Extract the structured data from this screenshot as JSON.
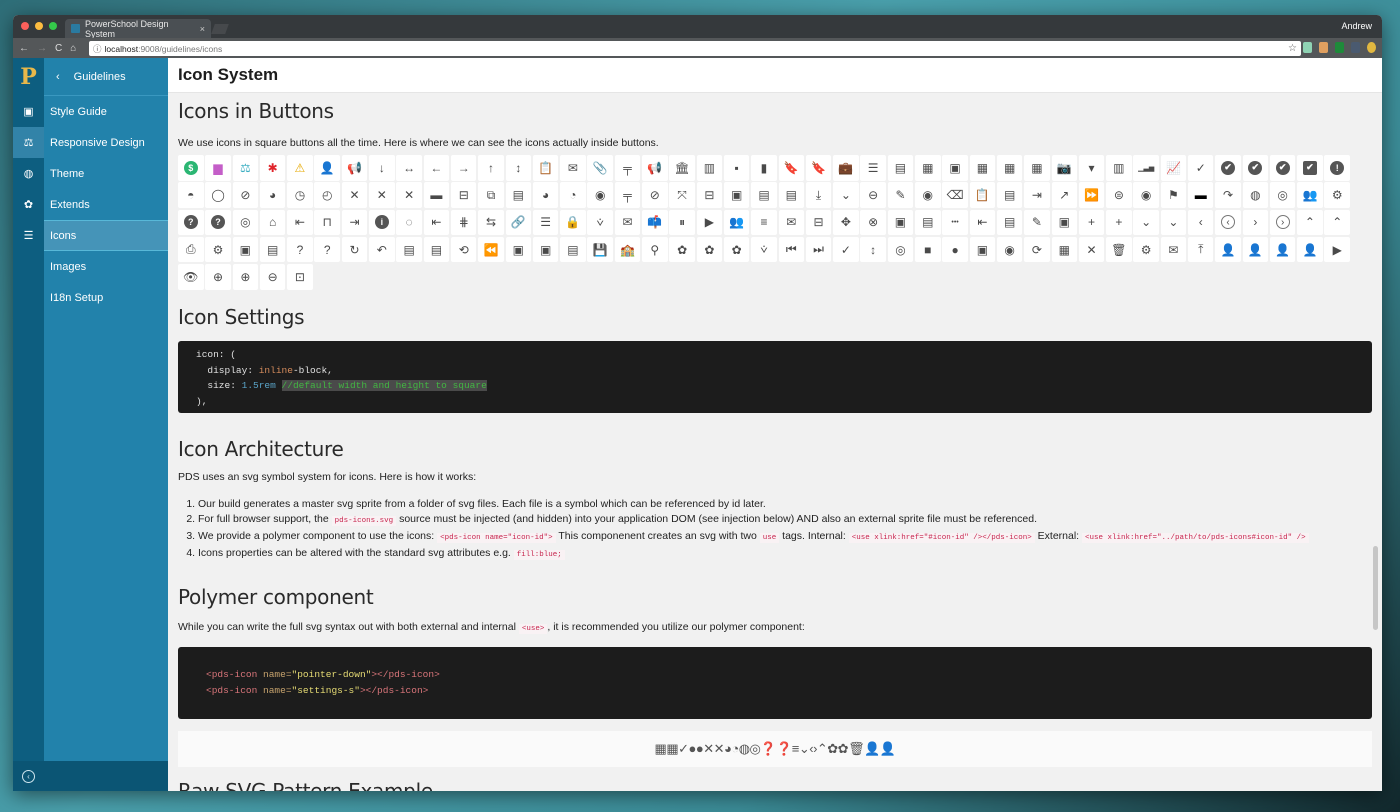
{
  "browser": {
    "tab_title": "PowerSchool Design System",
    "tab_close": "×",
    "user": "Andrew",
    "url_host": "localhost",
    "url_path": ":9008/guidelines/icons",
    "info_icon": "ⓘ",
    "star_icon": "☆",
    "nav": {
      "back": "←",
      "forward": "→",
      "reload": "C",
      "home": "⌂"
    }
  },
  "colors": {
    "sidebar_rail": "#0d5e80",
    "sidebar_nav": "#2282ab",
    "active_item": "#4594b8",
    "code_bg": "#1c1c1c"
  },
  "rail": {
    "logo": "P",
    "icons": [
      {
        "name": "style-guide-icon",
        "glyph": "▣"
      },
      {
        "name": "balance-icon",
        "glyph": "⚖"
      },
      {
        "name": "globe-icon",
        "glyph": "◍"
      },
      {
        "name": "gear-icon",
        "glyph": "✿"
      },
      {
        "name": "document-icon",
        "glyph": "☰"
      }
    ]
  },
  "sidenav": {
    "back_label": "Guidelines",
    "back_icon": "‹",
    "items": [
      {
        "label": "Style Guide"
      },
      {
        "label": "Responsive Design"
      },
      {
        "label": "Theme"
      },
      {
        "label": "Extends"
      },
      {
        "label": "Icons",
        "active": true
      },
      {
        "label": "Images"
      },
      {
        "label": "I18n Setup"
      }
    ],
    "collapse_icon": "‹"
  },
  "page": {
    "title": "Icon System",
    "sections": {
      "buttons": {
        "heading": "Icons in Buttons",
        "text": "We use icons in square buttons all the time. Here is where we can see the icons actually inside buttons."
      },
      "settings": {
        "heading": "Icon Settings",
        "code": {
          "l1": "icon: (",
          "l2a": "display: ",
          "l2b": "inline",
          "l2c": "-block,",
          "l3a": "size: ",
          "l3b": "1.5rem",
          "l3c": "//default width and height to square",
          "l4": "),"
        }
      },
      "architecture": {
        "heading": "Icon Architecture",
        "intro": "PDS uses an svg symbol system for icons. Here is how it works:",
        "items": [
          {
            "text": "Our build generates a master svg sprite from a folder of svg files. Each file is a symbol which can be referenced by id later."
          },
          {
            "a": "For full browser support, the ",
            "code": "pds-icons.svg",
            "b": " source must be injected (and hidden) into your application DOM (see injection below) AND also an external sprite file must be referenced."
          },
          {
            "a": "We provide a polymer component to use the icons: ",
            "code1": "<pds-icon name=\"icon-id\">",
            "b": " This componenent creates an svg with two ",
            "code2": "use",
            "c": " tags. Internal: ",
            "code3": "<use xlink:href=\"#icon-id\" /></pds-icon>",
            "d": " External: ",
            "code4": "<use xlink:href=\"../path/to/pds-icons#icon-id\" />"
          },
          {
            "a": "Icons properties can be altered with the standard svg attributes e.g. ",
            "code": "fill:blue;"
          }
        ]
      },
      "polymer": {
        "heading": "Polymer component",
        "text_a": "While you can write the full svg syntax out with both external and internal ",
        "text_code": "<use>",
        "text_b": ", it is recommended you utilize our polymer component:",
        "code": [
          {
            "tag_open": "<pds-icon",
            "attr": " name=",
            "value": "\"pointer-down\"",
            "tag_close": "></pds-icon>"
          },
          {
            "tag_open": "<pds-icon",
            "attr": " name=",
            "value": "\"settings-s\"",
            "tag_close": "></pds-icon>"
          }
        ],
        "strip_icons": "▦▦✓●●✕✕◕◔◍◎❓❓≡⌄‹›⌃✿✿🗑👤👤"
      },
      "next_heading_partial": "Raw SVG Pattern Example"
    },
    "icon_grid": [
      {
        "n": "dollar-circle",
        "g": "$",
        "c": "#fff",
        "bg": "#2bb673",
        "round": true
      },
      {
        "n": "birthday-cake",
        "g": "▆",
        "c": "#c45ec8"
      },
      {
        "n": "scale",
        "g": "⚖",
        "c": "#3aaec2"
      },
      {
        "n": "medical-star",
        "g": "✱",
        "c": "#e0242b"
      },
      {
        "n": "warning",
        "g": "⚠",
        "c": "#e6a800"
      },
      {
        "n": "user-purple",
        "g": "👤",
        "c": "#8a6bc8"
      },
      {
        "n": "megaphone",
        "g": "📢"
      },
      {
        "n": "arrow-down",
        "g": "↓"
      },
      {
        "n": "arrow-left-right",
        "g": "↔"
      },
      {
        "n": "arrow-left",
        "g": "←"
      },
      {
        "n": "arrow-right",
        "g": "→"
      },
      {
        "n": "arrow-up",
        "g": "↑"
      },
      {
        "n": "arrow-up-down",
        "g": "↕"
      },
      {
        "n": "clipboard",
        "g": "📋"
      },
      {
        "n": "envelope-open",
        "g": "✉"
      },
      {
        "n": "paperclip",
        "g": "📎"
      },
      {
        "n": "desk",
        "g": "╤"
      },
      {
        "n": "megaphone-2",
        "g": "📢"
      },
      {
        "n": "bank",
        "g": "🏛"
      },
      {
        "n": "building",
        "g": "▥"
      },
      {
        "n": "book-small",
        "g": "▪"
      },
      {
        "n": "book",
        "g": "▮"
      },
      {
        "n": "bookmark-add",
        "g": "🔖"
      },
      {
        "n": "bookmark",
        "g": "🔖"
      },
      {
        "n": "briefcase",
        "g": "💼"
      },
      {
        "n": "list",
        "g": "☰"
      },
      {
        "n": "drawer",
        "g": "▤"
      },
      {
        "n": "calculator",
        "g": "▦"
      },
      {
        "n": "calendar-1",
        "g": "▣"
      },
      {
        "n": "calendar-grid",
        "g": "▦"
      },
      {
        "n": "calendar-grid-2",
        "g": "▦"
      },
      {
        "n": "calendar-grid-3",
        "g": "▦"
      },
      {
        "n": "camera",
        "g": "📷"
      },
      {
        "n": "caret-down",
        "g": "▾"
      },
      {
        "n": "columns",
        "g": "▥"
      },
      {
        "n": "bar-chart",
        "g": "▁▃▅"
      },
      {
        "n": "trend-chart",
        "g": "📈"
      },
      {
        "n": "check",
        "g": "✓"
      },
      {
        "n": "check-circle",
        "g": "✔",
        "round": true,
        "bg": "#555",
        "c": "#fff"
      },
      {
        "n": "check-circle-2",
        "g": "✔",
        "round": true,
        "bg": "#555",
        "c": "#fff"
      },
      {
        "n": "check-circle-3",
        "g": "✔",
        "round": true,
        "bg": "#555",
        "c": "#fff"
      },
      {
        "n": "check-square",
        "g": "✔",
        "bg": "#555",
        "c": "#fff"
      },
      {
        "n": "exclamation-circle",
        "g": "!",
        "round": true,
        "bg": "#555",
        "c": "#fff"
      },
      {
        "n": "half-circle",
        "g": "◓"
      },
      {
        "n": "ellipse",
        "g": "◯"
      },
      {
        "n": "circle-slash",
        "g": "⊘"
      },
      {
        "n": "clock-add",
        "g": "◕"
      },
      {
        "n": "clock",
        "g": "◷"
      },
      {
        "n": "clock-2",
        "g": "◴"
      },
      {
        "n": "close",
        "g": "✕"
      },
      {
        "n": "close-2",
        "g": "✕"
      },
      {
        "n": "close-3",
        "g": "✕"
      },
      {
        "n": "comment",
        "g": "▬"
      },
      {
        "n": "compare",
        "g": "⊟"
      },
      {
        "n": "copy-add",
        "g": "⧉"
      },
      {
        "n": "csv",
        "g": "▤"
      },
      {
        "n": "dashboard-dark",
        "g": "◕"
      },
      {
        "n": "dashboard",
        "g": "◔"
      },
      {
        "n": "life-ring",
        "g": "◉"
      },
      {
        "n": "desk-2",
        "g": "╤"
      },
      {
        "n": "ban",
        "g": "⊘"
      },
      {
        "n": "distribute",
        "g": "⤧"
      },
      {
        "n": "toggle-bars",
        "g": "⊟"
      },
      {
        "n": "calendar-pic",
        "g": "▣"
      },
      {
        "n": "document",
        "g": "▤"
      },
      {
        "n": "document-2",
        "g": "▤"
      },
      {
        "n": "download",
        "g": "⤓"
      },
      {
        "n": "chevron-down",
        "g": "⌄"
      },
      {
        "n": "minus-circle",
        "g": "⊖"
      },
      {
        "n": "pencil",
        "g": "✎"
      },
      {
        "n": "user-circle",
        "g": "◉"
      },
      {
        "n": "backspace",
        "g": "⌫"
      },
      {
        "n": "clipboard-check",
        "g": "📋"
      },
      {
        "n": "xls",
        "g": "▤"
      },
      {
        "n": "sign-out",
        "g": "⇥"
      },
      {
        "n": "external-link",
        "g": "↗"
      },
      {
        "n": "fast-forward",
        "g": "⏩"
      },
      {
        "n": "filter-circle",
        "g": "⊜"
      },
      {
        "n": "filter-add",
        "g": "◉"
      },
      {
        "n": "flag",
        "g": "⚑"
      },
      {
        "n": "folder",
        "g": "▬",
        "c": "#000"
      },
      {
        "n": "redo",
        "g": "↷"
      },
      {
        "n": "globe-dark",
        "g": "◍"
      },
      {
        "n": "globe",
        "g": "◎"
      },
      {
        "n": "group",
        "g": "👥"
      },
      {
        "n": "group-settings",
        "g": "⚙"
      },
      {
        "n": "help-circle",
        "g": "?",
        "round": true,
        "bg": "#555",
        "c": "#fff"
      },
      {
        "n": "help-circle-2",
        "g": "?",
        "round": true,
        "bg": "#555",
        "c": "#fff"
      },
      {
        "n": "eye-slash",
        "g": "◎"
      },
      {
        "n": "home",
        "g": "⌂"
      },
      {
        "n": "sign-in",
        "g": "⇤"
      },
      {
        "n": "inbox",
        "g": "⊓"
      },
      {
        "n": "indent",
        "g": "⇥"
      },
      {
        "n": "info-circle",
        "g": "i",
        "round": true,
        "bg": "#555",
        "c": "#fff"
      },
      {
        "n": "circle-check-dashed",
        "g": "◌"
      },
      {
        "n": "sign-in-2",
        "g": "⇤"
      },
      {
        "n": "split-vertical",
        "g": "⋕"
      },
      {
        "n": "swap",
        "g": "⇆"
      },
      {
        "n": "link",
        "g": "🔗"
      },
      {
        "n": "list-bullets",
        "g": "☰"
      },
      {
        "n": "lock",
        "g": "🔒"
      },
      {
        "n": "pointer-down",
        "g": "⩒"
      },
      {
        "n": "mail",
        "g": "✉"
      },
      {
        "n": "mailbox",
        "g": "📫"
      },
      {
        "n": "pause",
        "g": "⏸"
      },
      {
        "n": "play",
        "g": "▶"
      },
      {
        "n": "people",
        "g": "👥"
      },
      {
        "n": "menu",
        "g": "≡"
      },
      {
        "n": "mail-2",
        "g": "✉"
      },
      {
        "n": "hierarchy",
        "g": "⊟"
      },
      {
        "n": "move",
        "g": "✥"
      },
      {
        "n": "x-circle",
        "g": "⊗"
      },
      {
        "n": "photo",
        "g": "▣"
      },
      {
        "n": "news",
        "g": "▤"
      },
      {
        "n": "ellipsis",
        "g": "•••"
      },
      {
        "n": "outdent",
        "g": "⇤"
      },
      {
        "n": "pdf",
        "g": "▤"
      },
      {
        "n": "edit-square",
        "g": "✎"
      },
      {
        "n": "id-card",
        "g": "▣"
      },
      {
        "n": "plus",
        "g": "+"
      },
      {
        "n": "plus-2",
        "g": "+"
      },
      {
        "n": "chevron-down-2",
        "g": "⌄"
      },
      {
        "n": "chevron-down-3",
        "g": "⌄"
      },
      {
        "n": "chevron-left",
        "g": "‹"
      },
      {
        "n": "chevron-left-circle",
        "g": "‹",
        "ring": true
      },
      {
        "n": "chevron-right",
        "g": "›"
      },
      {
        "n": "chevron-right-circle",
        "g": "›",
        "ring": true
      },
      {
        "n": "chevron-up",
        "g": "⌃"
      },
      {
        "n": "chevron-up-2",
        "g": "⌃"
      },
      {
        "n": "printer",
        "g": "⎙"
      },
      {
        "n": "gears",
        "g": "⚙"
      },
      {
        "n": "archive-box",
        "g": "▣"
      },
      {
        "n": "doc-edit",
        "g": "▤"
      },
      {
        "n": "question",
        "g": "?"
      },
      {
        "n": "question-2",
        "g": "?"
      },
      {
        "n": "refresh",
        "g": "↻"
      },
      {
        "n": "undo",
        "g": "↶"
      },
      {
        "n": "report",
        "g": "▤"
      },
      {
        "n": "archive",
        "g": "▤"
      },
      {
        "n": "history",
        "g": "⟲"
      },
      {
        "n": "rewind",
        "g": "⏪"
      },
      {
        "n": "badge",
        "g": "▣"
      },
      {
        "n": "contact",
        "g": "▣"
      },
      {
        "n": "spreadsheet",
        "g": "▤"
      },
      {
        "n": "save",
        "g": "💾"
      },
      {
        "n": "school",
        "g": "🏫"
      },
      {
        "n": "search",
        "g": "⚲"
      },
      {
        "n": "settings",
        "g": "✿"
      },
      {
        "n": "settings-2",
        "g": "✿"
      },
      {
        "n": "settings-3",
        "g": "✿"
      },
      {
        "n": "pointer-down-2",
        "g": "⩒"
      },
      {
        "n": "skip-back",
        "g": "⏮"
      },
      {
        "n": "skip-forward",
        "g": "⏭"
      },
      {
        "n": "spellcheck",
        "g": "✓"
      },
      {
        "n": "arrows-vertical",
        "g": "↕"
      },
      {
        "n": "target",
        "g": "◎"
      },
      {
        "n": "stop",
        "g": "■"
      },
      {
        "n": "stop-hand",
        "g": "●"
      },
      {
        "n": "id-badge",
        "g": "▣"
      },
      {
        "n": "rss",
        "g": "◉"
      },
      {
        "n": "sync",
        "g": "⟳"
      },
      {
        "n": "tiles",
        "g": "▦"
      },
      {
        "n": "tools",
        "g": "✕"
      },
      {
        "n": "trash",
        "g": "🗑"
      },
      {
        "n": "gear-group",
        "g": "⚙"
      },
      {
        "n": "mail-person",
        "g": "✉"
      },
      {
        "n": "upload",
        "g": "⤒"
      },
      {
        "n": "user-add",
        "g": "👤"
      },
      {
        "n": "user",
        "g": "👤"
      },
      {
        "n": "user-settings",
        "g": "👤"
      },
      {
        "n": "user-2",
        "g": "👤"
      },
      {
        "n": "video",
        "g": "▶"
      },
      {
        "n": "eye",
        "g": "👁"
      },
      {
        "n": "zoom-in",
        "g": "⊕"
      },
      {
        "n": "zoom-in-2",
        "g": "⊕"
      },
      {
        "n": "zoom-out",
        "g": "⊖"
      },
      {
        "n": "zoom-page",
        "g": "⊡"
      }
    ]
  }
}
